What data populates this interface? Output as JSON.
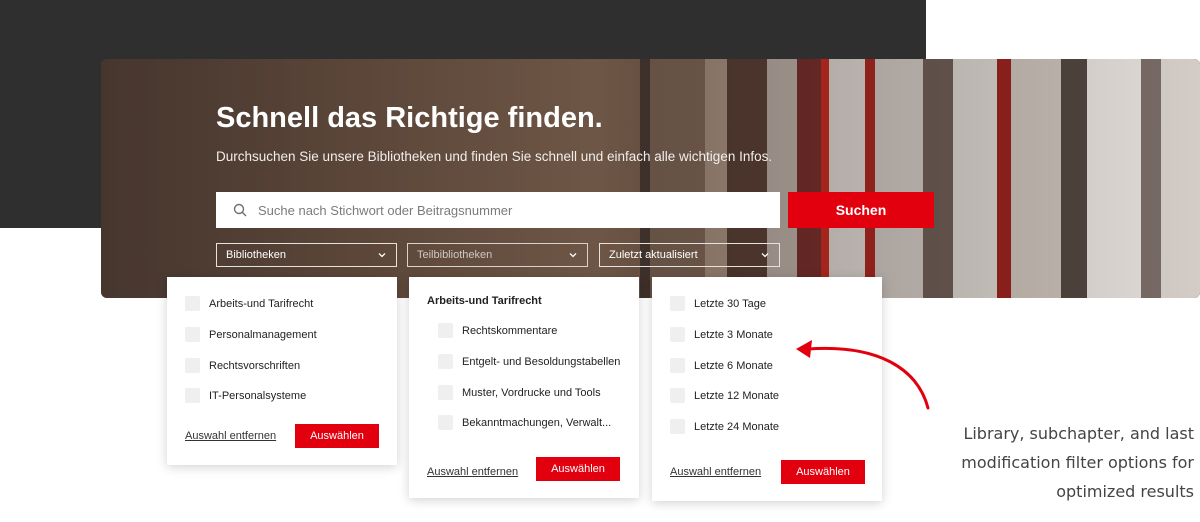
{
  "hero": {
    "title": "Schnell das Richtige finden.",
    "subtitle": "Durchsuchen Sie unsere Bibliotheken und finden Sie schnell und einfach alle wichtigen Infos."
  },
  "search": {
    "placeholder": "Suche nach Stichwort oder Beitragsnummer",
    "button_label": "Suchen",
    "icon": "search-icon"
  },
  "filters": {
    "libraries": {
      "label": "Bibliotheken"
    },
    "sublibraries": {
      "label": "Teilbibliotheken"
    },
    "updated": {
      "label": "Zuletzt aktualisiert"
    }
  },
  "panels": {
    "libraries": {
      "options": [
        "Arbeits-und Tarifrecht",
        "Personalmanagement",
        "Rechtsvorschriften",
        "IT-Personalsysteme"
      ],
      "clear_label": "Auswahl entfernen",
      "apply_label": "Auswählen"
    },
    "sublibraries": {
      "heading": "Arbeits-und Tarifrecht",
      "options": [
        "Rechtskommentare",
        "Entgelt- und Besoldungstabellen",
        "Muster, Vordrucke und Tools",
        "Bekanntmachungen, Verwalt..."
      ],
      "clear_label": "Auswahl entfernen",
      "apply_label": "Auswählen"
    },
    "updated": {
      "options": [
        "Letzte 30 Tage",
        "Letzte 3 Monate",
        "Letzte 6 Monate",
        "Letzte 12 Monate",
        "Letzte 24 Monate"
      ],
      "clear_label": "Auswahl entfernen",
      "apply_label": "Auswählen"
    }
  },
  "caption": {
    "lines": [
      "Library, subchapter, and last",
      "modification filter options for",
      "optimized results"
    ]
  },
  "colors": {
    "accent": "#e2000f",
    "dark": "#2f2f2f"
  }
}
